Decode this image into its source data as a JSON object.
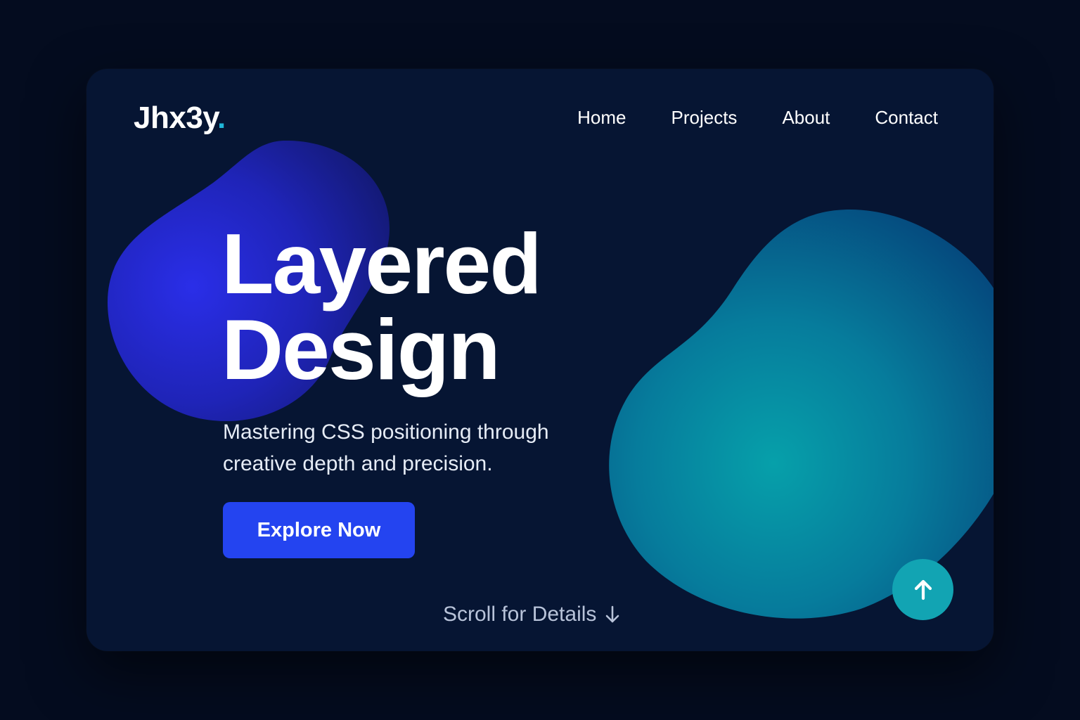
{
  "brand": {
    "name": "Jhx3y",
    "dot": ".",
    "dot_color": "#1fb6d9"
  },
  "nav": {
    "items": [
      {
        "label": "Home"
      },
      {
        "label": "Projects"
      },
      {
        "label": "About"
      },
      {
        "label": "Contact"
      }
    ]
  },
  "hero": {
    "title_line1": "Layered",
    "title_line2": "Design",
    "subtitle_line1": "Mastering CSS positioning through",
    "subtitle_line2": "creative depth and precision.",
    "cta_label": "Explore Now"
  },
  "scroll": {
    "label": "Scroll for Details",
    "icon": "arrow-down-icon"
  },
  "back_to_top": {
    "icon": "arrow-up-icon"
  },
  "colors": {
    "page_background": "#040c1f",
    "card_background": "#061533",
    "accent_blue": "#2444f0",
    "accent_teal": "#12a4b3",
    "blob_blue": "#2a2ee8",
    "blob_teal": "#06a0aa"
  }
}
